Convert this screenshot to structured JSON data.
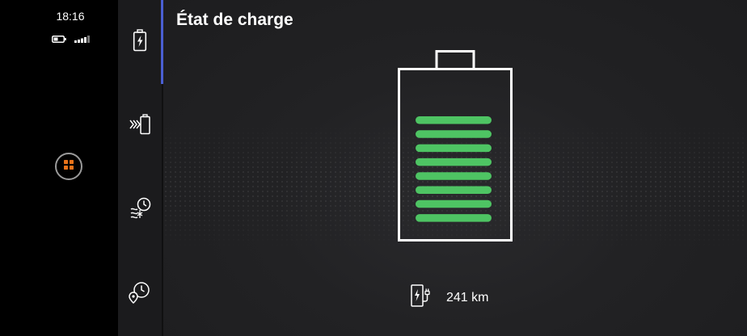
{
  "status": {
    "time": "18:16",
    "icons": [
      "phone-battery-icon",
      "signal-strength-icon"
    ]
  },
  "launcher": {
    "icon": "apps-grid-icon",
    "accent_color": "#e8731a"
  },
  "sidenav": {
    "accent_color": "#4a5fd3",
    "items": [
      {
        "id": "charge-state",
        "icon": "battery-bolt-icon",
        "active": true
      },
      {
        "id": "charge-settings",
        "icon": "battery-chevrons-icon",
        "active": false
      },
      {
        "id": "departure-timer",
        "icon": "climate-clock-icon",
        "active": false
      },
      {
        "id": "location-timer",
        "icon": "location-clock-icon",
        "active": false
      }
    ]
  },
  "main": {
    "title": "État de charge",
    "battery": {
      "level_bars": 8,
      "max_bars": 8,
      "bar_color": "#4ec463"
    },
    "range": {
      "icon": "charging-station-icon",
      "value": "241 km"
    }
  }
}
